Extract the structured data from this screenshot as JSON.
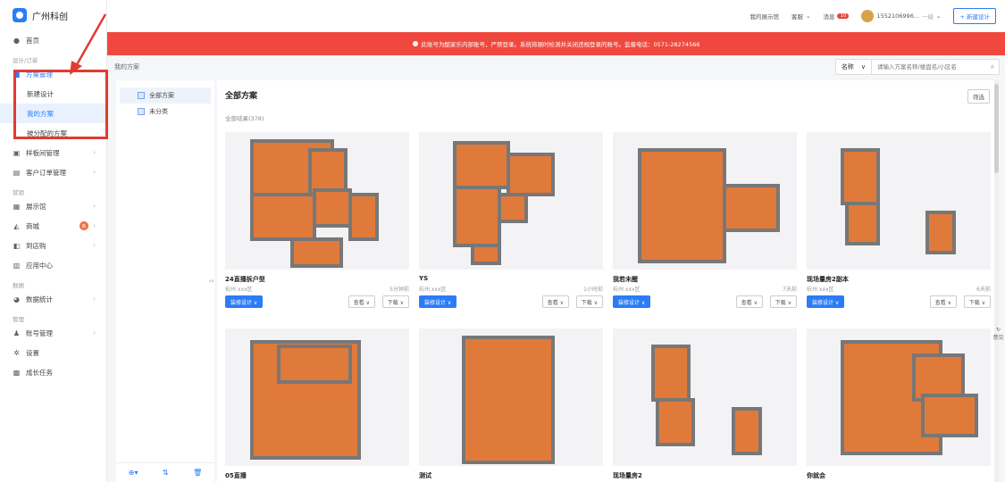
{
  "brand": {
    "name": "广州科创"
  },
  "sidebar": {
    "home": "首页",
    "group_design": "设计/订单",
    "plan_mgmt": "方案管理",
    "new_design": "新建设计",
    "my_plans": "我的方案",
    "assigned_plans": "被分配的方案",
    "showroom_mgmt": "样板间管理",
    "order_mgmt": "客户订单管理",
    "group_marketing": "营销",
    "showroom": "展示馆",
    "shop": "商城",
    "shop_badge": "新",
    "to_store": "到店购",
    "app_center": "应用中心",
    "group_data": "数据",
    "data_stats": "数据统计",
    "group_manage": "管理",
    "account_mgmt": "账号管理",
    "settings": "设置",
    "growth_tasks": "成长任务"
  },
  "topbar": {
    "my_showroom": "我的展示馆",
    "service": "客服",
    "messages": "消息",
    "message_count": "10",
    "account": "1552106996...",
    "account_extra": "一级",
    "new_design": "+ 新建设计"
  },
  "notice": "此账号为酷家乐内部账号，严禁登录。系统将随时检测并关闭违规登录的账号。监督电话：0571-28274566",
  "breadcrumb": "我的方案",
  "search": {
    "select_value": "名称",
    "placeholder": "请输入方案名称/楼盘名/小区名"
  },
  "folders": [
    {
      "label": "全部方案"
    },
    {
      "label": "未分类"
    }
  ],
  "main": {
    "title": "全部方案",
    "count": "全部结果(378)",
    "filter": "筛选",
    "decorate_btn": "装修设计 ∨",
    "view_btn": "查看 ∨",
    "download_btn": "下载 ∨"
  },
  "cards": [
    {
      "name": "24直播拆户型",
      "location": "杭州 xxx区",
      "time": "5分钟前"
    },
    {
      "name": "YS",
      "location": "杭州 xxx区",
      "time": "1小时前"
    },
    {
      "name": "我若未醒",
      "location": "杭州 xxx区",
      "time": "7天前"
    },
    {
      "name": "现场量房2副本",
      "location": "杭州 xxx区",
      "time": "6天前"
    },
    {
      "name": "05直播",
      "location": "",
      "time": ""
    },
    {
      "name": "测试",
      "location": "",
      "time": ""
    },
    {
      "name": "现场量房2",
      "location": "",
      "time": ""
    },
    {
      "name": "你就会",
      "location": "",
      "time": ""
    }
  ],
  "feedback": "意见",
  "colors": {
    "accent": "#2b7cf6",
    "notice": "#f0483e",
    "highlight": "#e03b32",
    "floor": "#e07a3a"
  }
}
